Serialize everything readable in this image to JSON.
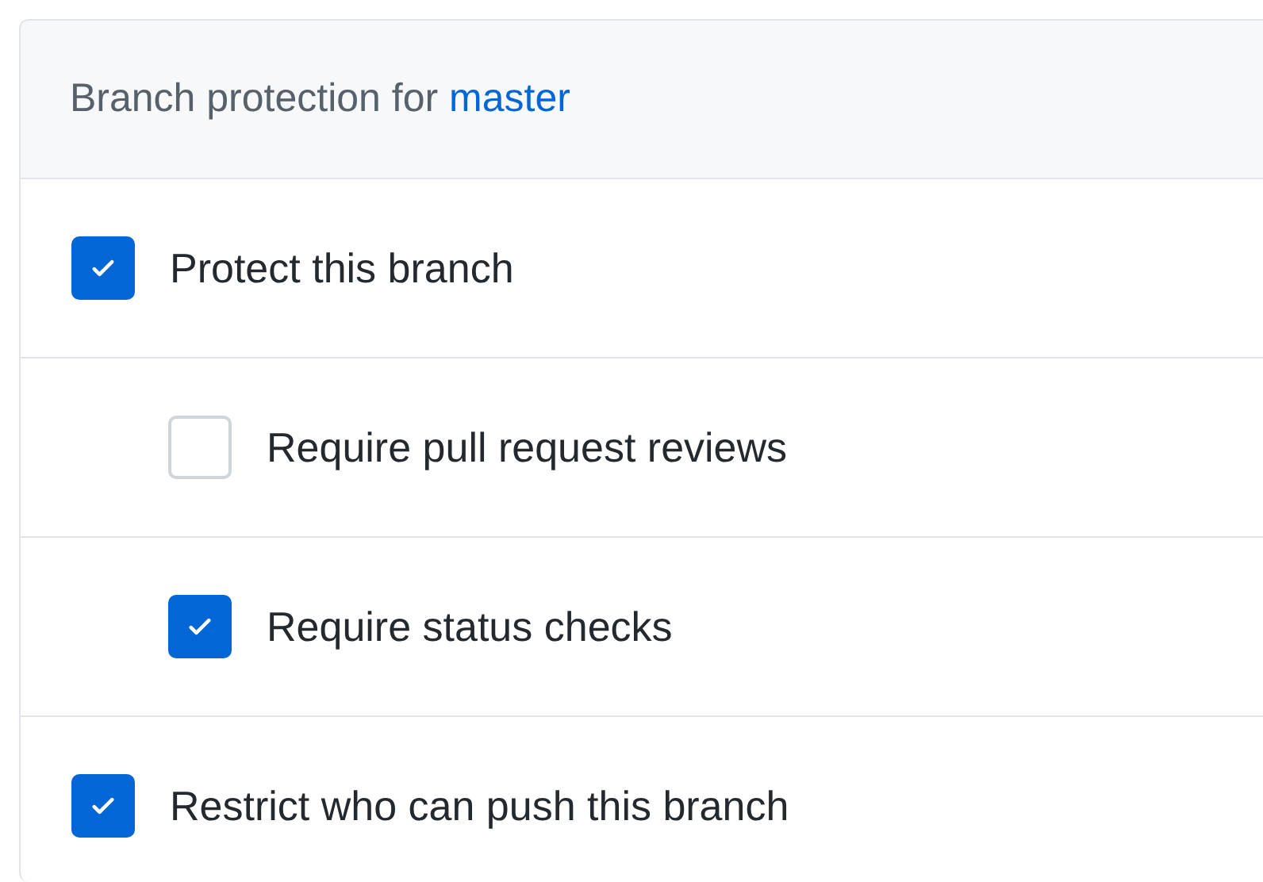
{
  "header": {
    "text": "Branch protection for ",
    "branch": "master"
  },
  "options": [
    {
      "label": "Protect this branch",
      "checked": true,
      "children": [
        {
          "label": "Require pull request reviews",
          "checked": false
        },
        {
          "label": "Require status checks",
          "checked": true
        }
      ]
    },
    {
      "label": "Restrict who can push this branch",
      "checked": true
    }
  ]
}
